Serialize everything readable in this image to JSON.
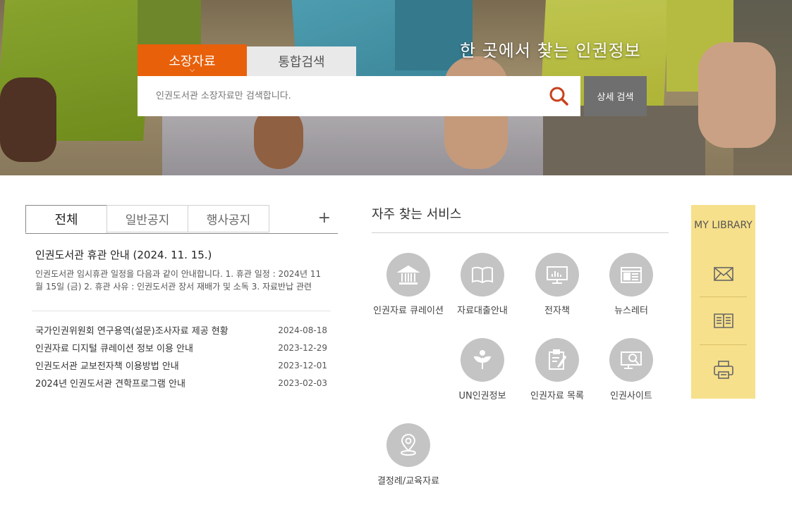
{
  "hero": {
    "title": "한 곳에서 찾는 인권정보"
  },
  "search": {
    "tabs": [
      {
        "label": "소장자료",
        "active": true
      },
      {
        "label": "통합검색",
        "active": false
      }
    ],
    "placeholder": "인권도서관 소장자료만 검색합니다.",
    "advanced_label": "상세 검색",
    "accent": "#e8600a"
  },
  "notice": {
    "tabs": [
      {
        "label": "전체",
        "active": true
      },
      {
        "label": "일반공지",
        "active": false
      },
      {
        "label": "행사공지",
        "active": false
      }
    ],
    "more_label": "+",
    "featured": {
      "title": "인권도서관 휴관 안내 (2024. 11. 15.)",
      "body": "인권도서관 임시휴관 일정을 다음과 같이 안내합니다. 1. 휴관 일정 : 2024년 11월 15일 (금) 2. 휴관 사유 : 인권도서관 장서 재배가 및 소독 3. 자료반납 관련"
    },
    "items": [
      {
        "title": "국가인권위원회 연구용역(설문)조사자료 제공 현황",
        "date": "2024-08-18"
      },
      {
        "title": "인권자료 디지털 큐레이션 정보 이용 안내",
        "date": "2023-12-29"
      },
      {
        "title": "인권도서관 교보전자책 이용방법 안내",
        "date": "2023-12-01"
      },
      {
        "title": "2024년 인권도서관 견학프로그램 안내",
        "date": "2023-02-03"
      }
    ]
  },
  "services": {
    "title": "자주 찾는 서비스",
    "items": [
      {
        "label": "인권자료 큐레이션",
        "icon": "museum-icon"
      },
      {
        "label": "자료대출안내",
        "icon": "book-icon"
      },
      {
        "label": "전자책",
        "icon": "monitor-chart-icon"
      },
      {
        "label": "뉴스레터",
        "icon": "newspaper-icon"
      },
      {
        "label": "UN인권정보",
        "icon": "sprout-hand-icon"
      },
      {
        "label": "인권자료 목록",
        "icon": "clipboard-pen-icon"
      },
      {
        "label": "인권사이트",
        "icon": "monitor-search-icon"
      },
      {
        "label": "결정례/교육자료",
        "icon": "map-pin-icon"
      }
    ]
  },
  "my_library": {
    "title": "MY LIBRARY",
    "icons": [
      "mail-icon",
      "catalog-icon",
      "print-icon"
    ],
    "color": "#f7e08b"
  }
}
